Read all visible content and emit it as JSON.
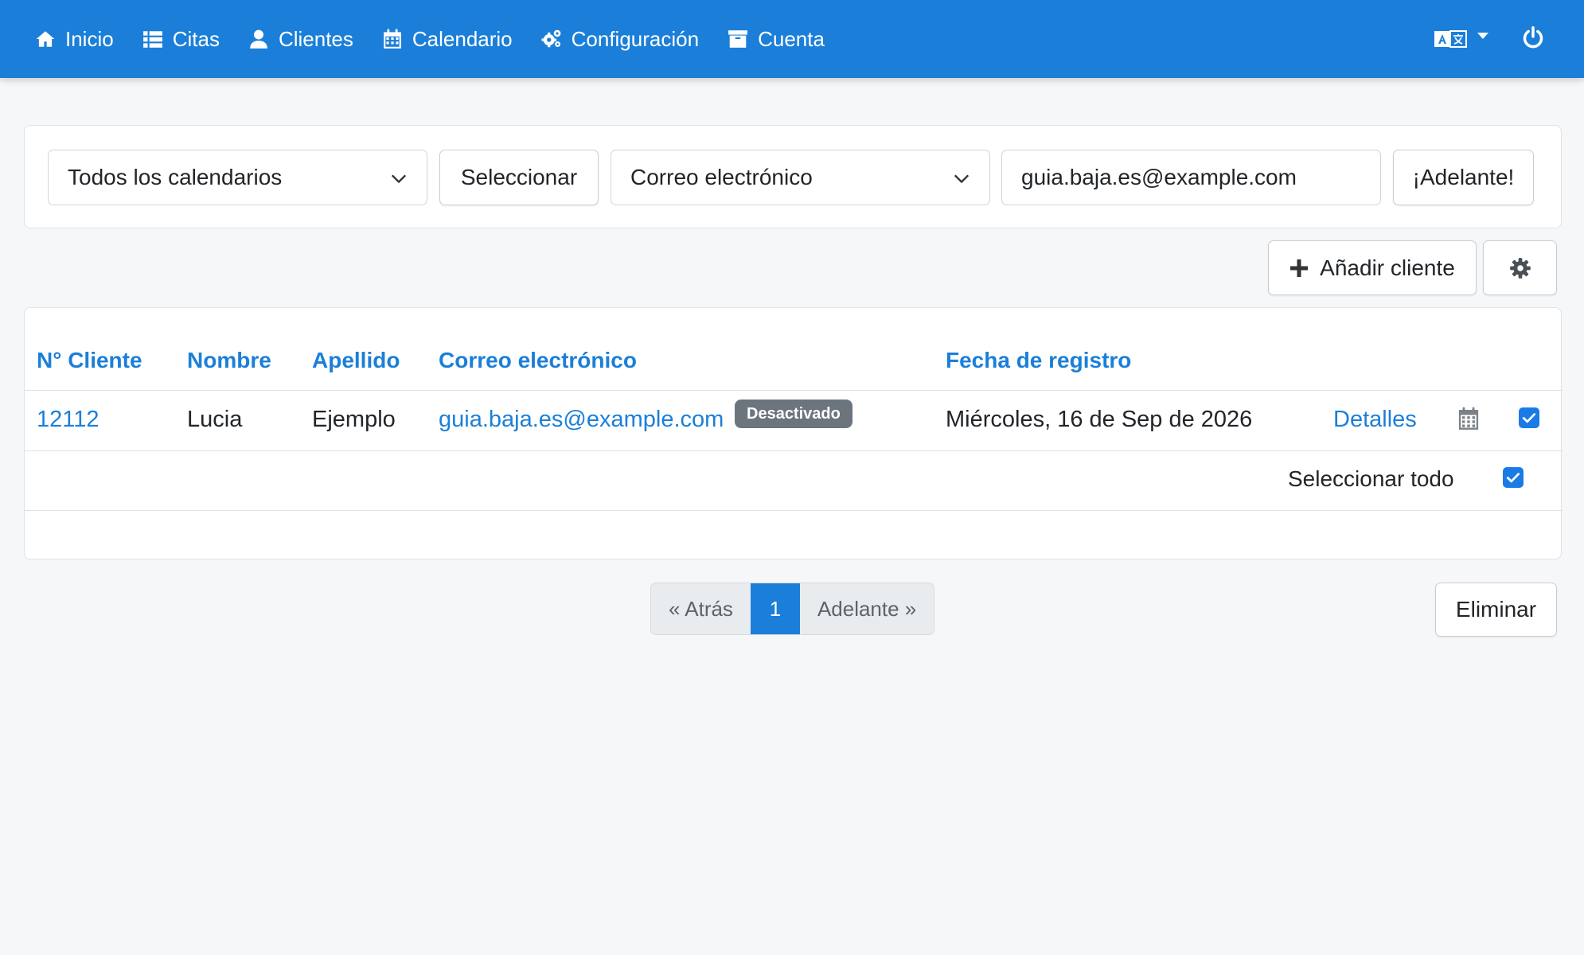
{
  "nav": {
    "items": [
      {
        "label": "Inicio",
        "icon": "home-icon"
      },
      {
        "label": "Citas",
        "icon": "list-icon"
      },
      {
        "label": "Clientes",
        "icon": "user-icon"
      },
      {
        "label": "Calendario",
        "icon": "calendar-icon"
      },
      {
        "label": "Configuración",
        "icon": "cogs-icon"
      },
      {
        "label": "Cuenta",
        "icon": "archive-icon"
      }
    ],
    "language_icon": "translate-icon",
    "power_icon": "power-icon",
    "bar_color": "#1b7fd9"
  },
  "filter": {
    "calendar_select": "Todos los calendarios",
    "select_button": "Seleccionar",
    "field_select": "Correo electrónico",
    "search_value": "guia.baja.es@example.com",
    "go_button": "¡Adelante!"
  },
  "actions": {
    "add_client": "Añadir cliente",
    "settings_icon": "gear-icon"
  },
  "table": {
    "headers": {
      "id": "N° Cliente",
      "first_name": "Nombre",
      "last_name": "Apellido",
      "email": "Correo electrónico",
      "registered": "Fecha de registro"
    },
    "rows": [
      {
        "id": "12112",
        "first_name": "Lucia",
        "last_name": "Ejemplo",
        "email": "guia.baja.es@example.com",
        "badge": "Desactivado",
        "registered": "Miércoles, 16 de Sep de 2026",
        "details": "Detalles",
        "checked": true
      }
    ],
    "select_all": "Seleccionar todo"
  },
  "pagination": {
    "prev": "« Atrás",
    "current": "1",
    "next": "Adelante »"
  },
  "delete_button": "Eliminar",
  "colors": {
    "accent": "#1b7fd9",
    "checkbox": "#1a7be6",
    "badge": "#6c757d",
    "background": "#f6f7f9"
  }
}
